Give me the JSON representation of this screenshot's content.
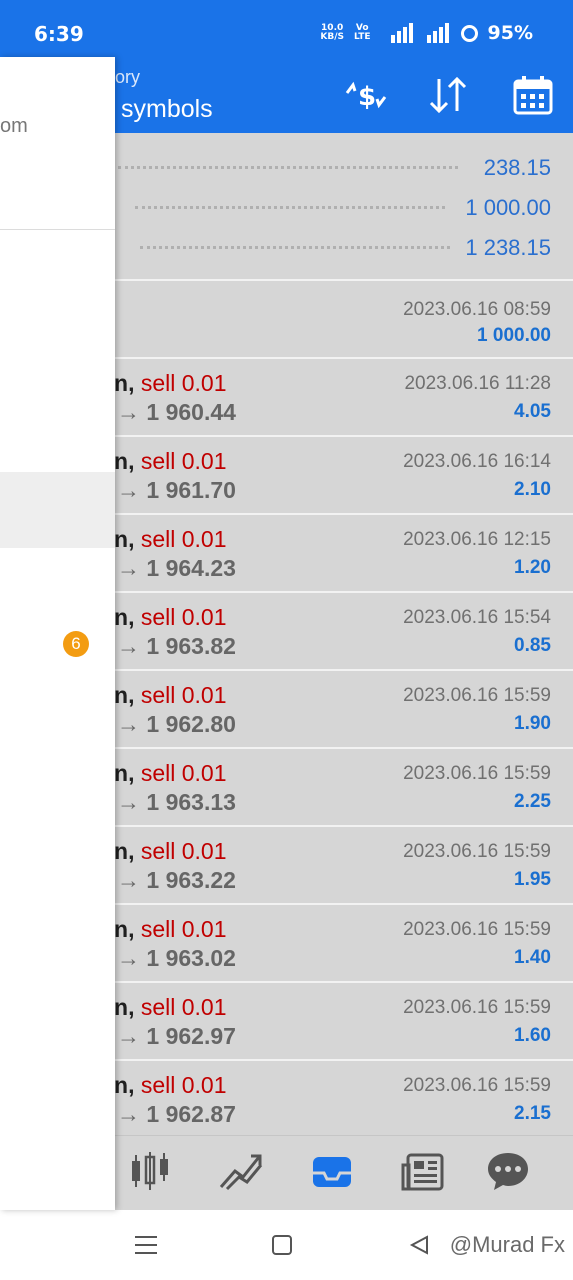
{
  "status_bar": {
    "time": "6:39",
    "net_speed_top": "10.0",
    "net_speed_bottom": "KB/S",
    "volte_top": "Vo",
    "volte_bottom": "LTE",
    "battery": "95%"
  },
  "toolbar": {
    "subtitle": "tory",
    "title": "symbols",
    "icons": [
      "currency-exchange-icon",
      "sort-icon",
      "calendar-icon"
    ]
  },
  "balance": {
    "rows": [
      "238.15",
      "1 000.00",
      "1 238.15"
    ]
  },
  "deposit": {
    "date": "2023.06.16 08:59",
    "amount": "1 000.00"
  },
  "deals": [
    {
      "symbol": "n",
      "comma": ",",
      "action": "sell 0.01",
      "price": "→ 1 960.44",
      "date": "2023.06.16 11:28",
      "profit": "4.05"
    },
    {
      "symbol": "n",
      "comma": ",",
      "action": "sell 0.01",
      "price": "→ 1 961.70",
      "date": "2023.06.16 16:14",
      "profit": "2.10"
    },
    {
      "symbol": "n",
      "comma": ",",
      "action": "sell 0.01",
      "price": "→ 1 964.23",
      "date": "2023.06.16 12:15",
      "profit": "1.20"
    },
    {
      "symbol": "n",
      "comma": ",",
      "action": "sell 0.01",
      "price": "→ 1 963.82",
      "date": "2023.06.16 15:54",
      "profit": "0.85"
    },
    {
      "symbol": "n",
      "comma": ",",
      "action": "sell 0.01",
      "price": "→ 1 962.80",
      "date": "2023.06.16 15:59",
      "profit": "1.90"
    },
    {
      "symbol": "n",
      "comma": ",",
      "action": "sell 0.01",
      "price": "→ 1 963.13",
      "date": "2023.06.16 15:59",
      "profit": "2.25"
    },
    {
      "symbol": "n",
      "comma": ",",
      "action": "sell 0.01",
      "price": "→ 1 963.22",
      "date": "2023.06.16 15:59",
      "profit": "1.95"
    },
    {
      "symbol": "n",
      "comma": ",",
      "action": "sell 0.01",
      "price": "→ 1 963.02",
      "date": "2023.06.16 15:59",
      "profit": "1.40"
    },
    {
      "symbol": "n",
      "comma": ",",
      "action": "sell 0.01",
      "price": "→ 1 962.97",
      "date": "2023.06.16 15:59",
      "profit": "1.60"
    },
    {
      "symbol": "n",
      "comma": ",",
      "action": "sell 0.01",
      "price": "→ 1 962.87",
      "date": "2023.06.16 15:59",
      "profit": "2.15"
    }
  ],
  "drawer": {
    "text_fragment": "om",
    "badge_count": "6"
  },
  "bottom_nav": {
    "icons": [
      "candlestick-chart-icon",
      "trade-chart-icon",
      "history-inbox-icon",
      "news-icon",
      "chat-icon"
    ],
    "active": "history-inbox-icon"
  },
  "system_nav": {
    "watermark": "@Murad Fx"
  },
  "colors": {
    "primary": "#1a73e8",
    "sell": "#c00000",
    "profit": "#1a6fd0",
    "badge": "#f39c12"
  }
}
